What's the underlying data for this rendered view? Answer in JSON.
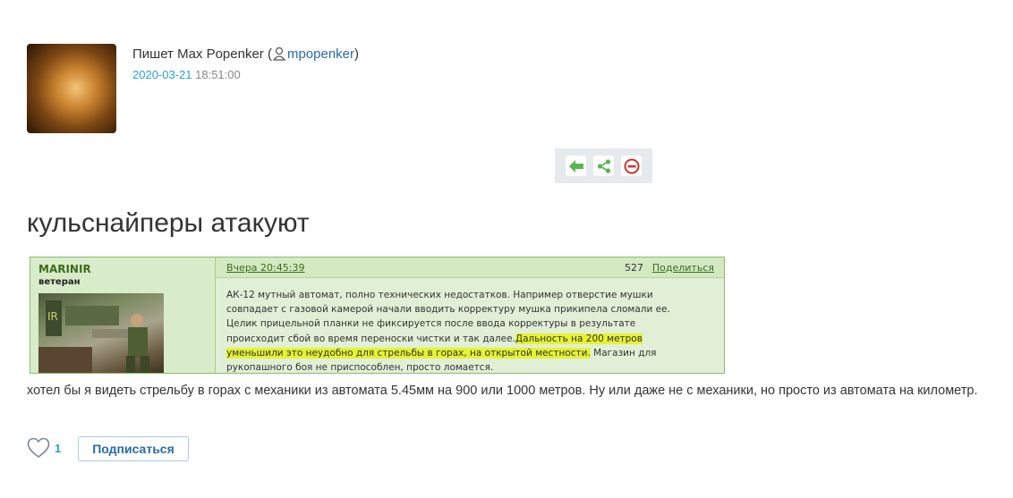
{
  "header": {
    "author_prefix": "Пишет Max Popenker (",
    "username": "mpopenker",
    "author_suffix": ")",
    "date": "2020-03-21",
    "time": "18:51:00"
  },
  "actions": {
    "icons": [
      "reply-arrow-icon",
      "share-icon",
      "block-icon"
    ],
    "colors": {
      "green": "#5bb552",
      "red": "#cc3333"
    }
  },
  "post": {
    "title": "кульснайперы атакуют",
    "text": "хотел бы я видеть стрельбу в горах с механики из автомата 5.45мм на 900 или 1000 метров. Ну или даже не с механики, но просто из автомата на километр."
  },
  "forum_embed": {
    "nick": "MARINIR",
    "rank": "ветеран",
    "timestamp": "Вчера 20:45:39",
    "count": "527",
    "share_label": "Поделиться",
    "text_before": "АК-12 мутный автомат, полно технических недостатков. Например отверстие мушки совпадает с газовой камерой начали вводить корректуру мушка прикипела сломали ее. Целик прицельной планки не фиксируется после ввода корректуры в результате происходит сбой во время переноски чистки и так далее.",
    "text_highlight": "Дальность на 200 метров уменьшили это неудобно для стрельбы в горах, на открытой местности.",
    "text_after": " Магазин для рукопашного боя не приспособлен, просто ломается."
  },
  "footer": {
    "like_count": "1",
    "subscribe_label": "Подписаться"
  }
}
